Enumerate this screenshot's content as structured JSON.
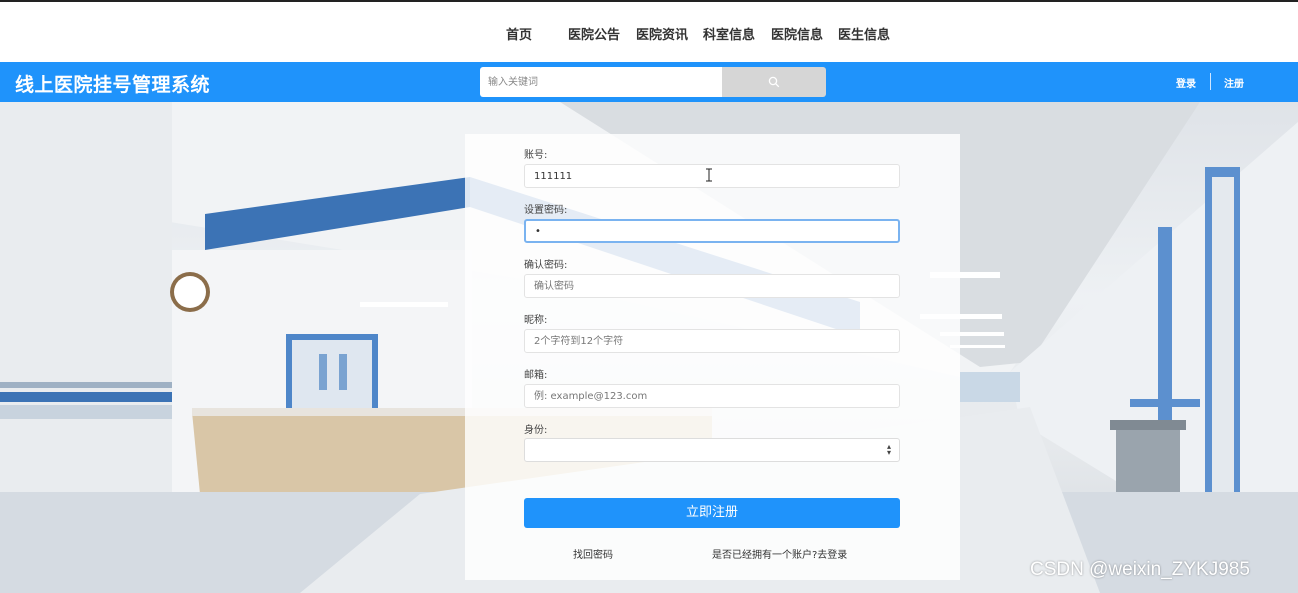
{
  "nav": {
    "items": [
      "首页",
      "医院公告",
      "医院资讯",
      "科室信息",
      "医院信息",
      "医生信息"
    ]
  },
  "header": {
    "brand": "线上医院挂号管理系统",
    "search_placeholder": "输入关键词",
    "search_icon": "search-icon",
    "login": "登录",
    "register": "注册",
    "bar_color": "#1f93fb"
  },
  "form": {
    "account_label": "账号:",
    "account_value": "111111",
    "password_label": "设置密码:",
    "password_value": "•",
    "confirm_label": "确认密码:",
    "confirm_placeholder": "确认密码",
    "nickname_label": "昵称:",
    "nickname_placeholder": "2个字符到12个字符",
    "email_label": "邮箱:",
    "email_placeholder": "例: example@123.com",
    "identity_label": "身份:",
    "identity_value": "",
    "submit": "立即注册",
    "forgot": "找回密码",
    "has_account": "是否已经拥有一个账户?去登录"
  },
  "watermark": "CSDN @weixin_ZYKJ985"
}
